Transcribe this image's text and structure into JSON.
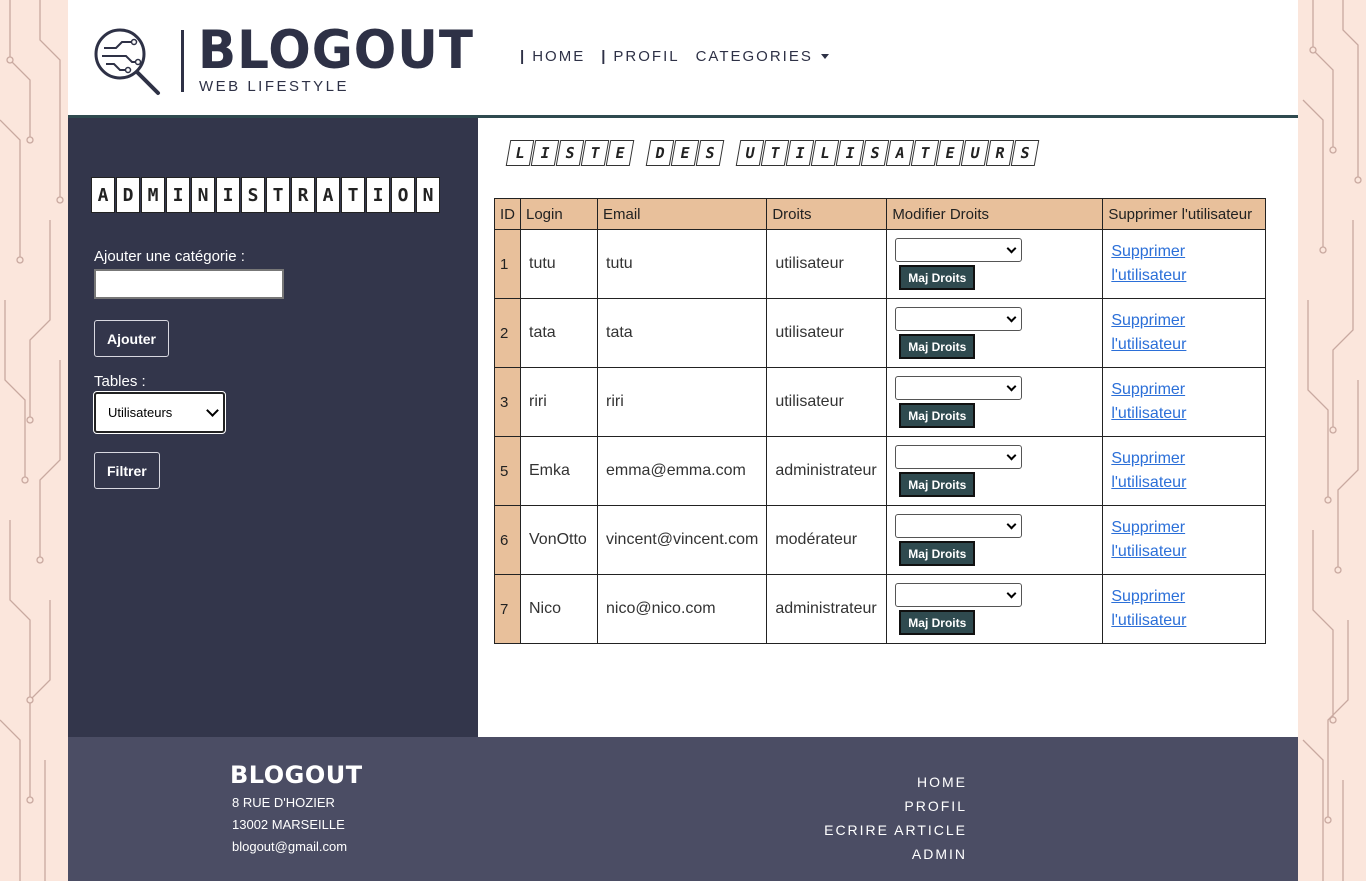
{
  "header": {
    "logo_title": "BLOGOUT",
    "logo_subtitle": "WEB LIFESTYLE",
    "nav": [
      {
        "label": "HOME",
        "sep": "|"
      },
      {
        "label": "PROFIL",
        "sep": "|"
      },
      {
        "label": "CATEGORIES",
        "sep": ""
      }
    ]
  },
  "sidebar": {
    "title_letters": [
      "A",
      "D",
      "M",
      "I",
      "N",
      "I",
      "S",
      "T",
      "R",
      "A",
      "T",
      "I",
      "O",
      "N"
    ],
    "add_category_label": "Ajouter une catégorie :",
    "add_category_value": "",
    "add_button": "Ajouter",
    "tables_label": "Tables :",
    "tables_selected": "Utilisateurs",
    "filter_button": "Filtrer"
  },
  "main": {
    "title_words": [
      "LISTE",
      "DES",
      "UTILISATEURS"
    ],
    "columns": [
      "ID",
      "Login",
      "Email",
      "Droits",
      "Modifier Droits",
      "Supprimer l'utilisateur"
    ],
    "update_button": "Maj Droits",
    "delete_link_line1": "Supprimer",
    "delete_link_line2": "l'utilisateur",
    "rows": [
      {
        "id": "1",
        "login": "tutu",
        "email": "tutu",
        "droits": "utilisateur"
      },
      {
        "id": "2",
        "login": "tata",
        "email": "tata",
        "droits": "utilisateur"
      },
      {
        "id": "3",
        "login": "riri",
        "email": "riri",
        "droits": "utilisateur"
      },
      {
        "id": "5",
        "login": "Emka",
        "email": "emma@emma.com",
        "droits": "administrateur"
      },
      {
        "id": "6",
        "login": "VonOtto",
        "email": "vincent@vincent.com",
        "droits": "modérateur"
      },
      {
        "id": "7",
        "login": "Nico",
        "email": "nico@nico.com",
        "droits": "administrateur"
      }
    ]
  },
  "footer": {
    "logo": "BLOGOUT",
    "address1": "8 RUE D'HOZIER",
    "address2": "13002 MARSEILLE",
    "email": "blogout@gmail.com",
    "nav": [
      "HOME",
      "PROFIL",
      "ECRIRE ARTICLE",
      "ADMIN"
    ]
  },
  "colors": {
    "sidebar_bg": "#33364b",
    "footer_bg": "#4b4d64",
    "table_header_bg": "#e8c09b",
    "button_bg": "#2f4a4f",
    "link": "#2b6fd8"
  }
}
